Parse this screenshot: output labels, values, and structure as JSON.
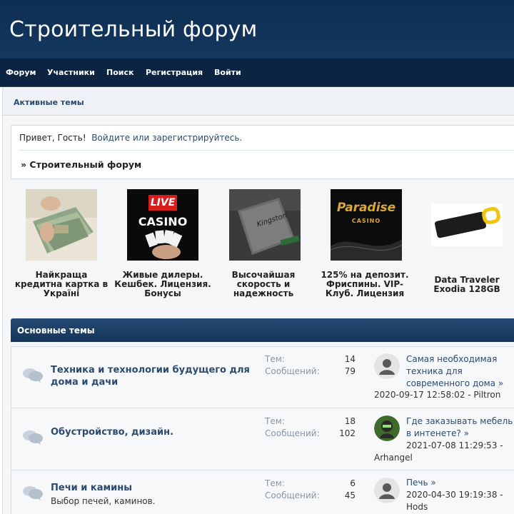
{
  "header": {
    "title": "Строительный форум"
  },
  "nav": {
    "items": [
      "Форум",
      "Участники",
      "Поиск",
      "Регистрация",
      "Войти"
    ]
  },
  "breadcrumb": {
    "active_topics": "Активные темы"
  },
  "info": {
    "greeting": "Привет, Гость!",
    "login_link": "Войдите",
    "or": "или",
    "register_link": "зарегистрируйтесь.",
    "forum_crumb": "» Строительный форум"
  },
  "ads": [
    {
      "caption": "Найкраща кредитна картка в Україні",
      "icon": "money-photo"
    },
    {
      "caption": "Живые дилеры. Кешбек. Лицензия. Бонусы",
      "icon": "live-casino-banner",
      "banner_top": "LIVE",
      "banner_bottom": "CASINO"
    },
    {
      "caption": "Высочайшая скорость и надежность",
      "icon": "ssd-photo",
      "brand": "Kingston"
    },
    {
      "caption": "125% на депозит. Фриспины. VIP-Клуб. Лицензия",
      "icon": "paradise-casino-banner",
      "banner_top": "Paradise",
      "banner_bottom": "CASINO"
    },
    {
      "caption": "Data Traveler Exodia 128GB",
      "icon": "usb-drive-photo"
    }
  ],
  "section": {
    "title": "Основные темы"
  },
  "boards": [
    {
      "name": "Техника и технологии будущего для дома и дачи",
      "description": "",
      "topics_label": "Тем:",
      "topics": "14",
      "posts_label": "Сообщений:",
      "posts": "79",
      "last_post_title": "Самая необходимая техника для современного дома",
      "last_post_meta": "2020-09-17 12:58:02 - Piltron",
      "avatar": "default-avatar-icon"
    },
    {
      "name": "Обустройство, дизайн.",
      "description": "",
      "topics_label": "Тем:",
      "topics": "18",
      "posts_label": "Сообщений:",
      "posts": "102",
      "last_post_title": "Где заказывать мебель в интенете?",
      "last_post_meta_line1": "2021-07-08 11:29:53 -",
      "last_post_meta_line2": "Arhangel",
      "avatar": "green-avatar-icon"
    },
    {
      "name": "Печи и камины",
      "description": "Выбор печей, каминов.",
      "topics_label": "Тем:",
      "topics": "6",
      "posts_label": "Сообщений:",
      "posts": "45",
      "last_post_title": "Печь",
      "last_post_meta_line1": "2020-04-30 19:19:38 -",
      "last_post_meta_line2": "Hods",
      "avatar": "default-avatar-icon"
    }
  ],
  "colors": {
    "header_bg": "#0e2d52",
    "nav_bg": "#0b2442",
    "link": "#2c4a6e",
    "section_header": "#1c3f66"
  }
}
